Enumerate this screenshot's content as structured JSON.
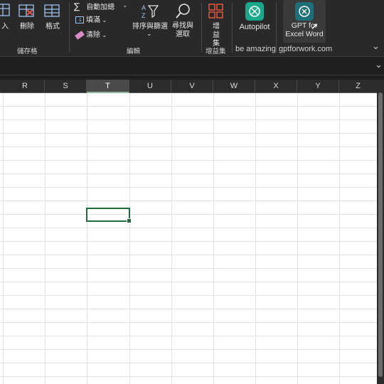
{
  "ribbon": {
    "cells_group": {
      "insert_label": "入",
      "delete_label": "刪除",
      "format_label": "格式",
      "group_label": "儲存格"
    },
    "editing_group": {
      "autosum_label": "自動加總",
      "fill_label": "填滿",
      "clear_label": "清除",
      "sort_filter_label": "排序與篩選",
      "find_select_label": "尋找與選取",
      "group_label": "編輯"
    },
    "addins_group": {
      "addins_label": "增益集",
      "group_label": "增益集"
    },
    "autopilot": {
      "label": "Autopilot",
      "group_label": "be amazing"
    },
    "gpt": {
      "label": "GPT for Excel Word",
      "group_label": "gptforwork.com"
    }
  },
  "columns": [
    "R",
    "S",
    "T",
    "U",
    "V",
    "W",
    "X",
    "Y",
    "Z"
  ],
  "active_column": "T",
  "colors": {
    "ribbon_bg": "#292929",
    "selection": "#1e6b3e",
    "addins_icon": "#e0593c",
    "autopilot_icon": "#1aa88a",
    "gpt_icon": "#1f6f79"
  }
}
